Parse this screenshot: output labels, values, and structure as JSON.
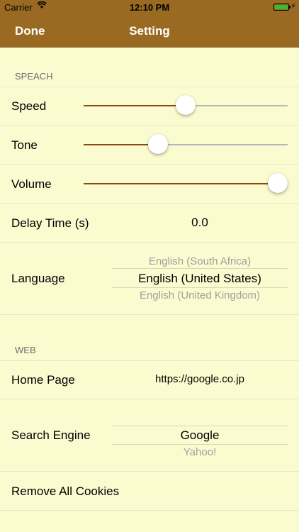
{
  "status_bar": {
    "carrier": "Carrier",
    "time": "12:10 PM",
    "battery_color": "#2fc12f"
  },
  "nav": {
    "done_label": "Done",
    "title": "Setting",
    "background": "#9a6a22"
  },
  "speach": {
    "header": "SPEACH",
    "speed_label": "Speed",
    "speed_value": 0.5,
    "tone_label": "Tone",
    "tone_value": 0.35,
    "volume_label": "Volume",
    "volume_value": 1.0,
    "delay_label": "Delay Time (s)",
    "delay_value": "0.0",
    "language_label": "Language",
    "language_options": [
      "English (South Africa)",
      "English (United States)",
      "English (United Kingdom)"
    ],
    "language_selected": "English (United States)"
  },
  "web": {
    "header": "WEB",
    "home_label": "Home Page",
    "home_value": "https://google.co.jp",
    "engine_label": "Search  Engine",
    "engine_options": [
      "Google",
      "Yahoo!"
    ],
    "engine_selected": "Google",
    "remove_cookies_label": "Remove All Cookies"
  },
  "colors": {
    "background": "#fbfbd0",
    "slider_fill": "#8a4b12",
    "slider_track": "#b6b6b6"
  },
  "icons": [
    "wifi-icon",
    "battery-icon",
    "charging-icon"
  ]
}
